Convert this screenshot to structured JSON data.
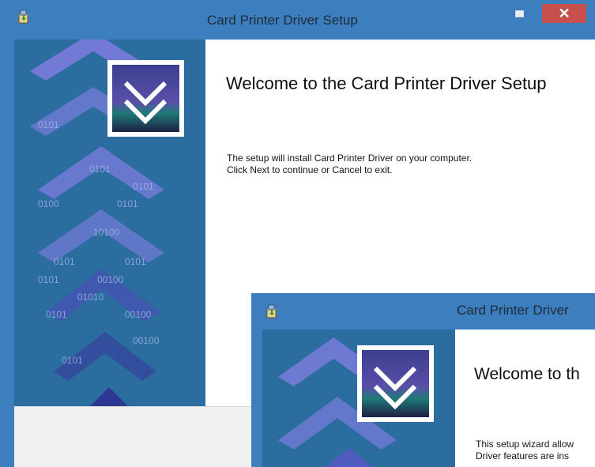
{
  "window_main": {
    "title": "Card Printer Driver Setup",
    "heading": "Welcome to the Card Printer Driver Setup",
    "body_line1": "The setup will install Card Printer Driver on your computer.",
    "body_line2": "Click Next to continue or Cancel to exit.",
    "close_glyph": "✕"
  },
  "window_secondary": {
    "title": "Card Printer Driver",
    "heading": "Welcome to th",
    "body_line1": "This setup wizard allow",
    "body_line2": "Driver features are ins"
  },
  "sidebar": {
    "binary_strings": [
      "0101",
      "0101",
      "0101",
      "0100",
      "0101",
      "10100",
      "0101",
      "0101",
      "00100",
      "0101",
      "01010",
      "00100",
      "0101",
      "00100",
      "0101"
    ]
  },
  "colors": {
    "titlebar": "#3d7ebf",
    "close_button": "#c7504c",
    "sidebar": "#2a6d9e",
    "chevron": "#7f7de0"
  },
  "icons": {
    "app_icon": "setup-installer-icon",
    "logo_icon": "double-chevron-down-icon",
    "minimize_icon": "minimize-icon",
    "close_icon": "close-icon"
  }
}
